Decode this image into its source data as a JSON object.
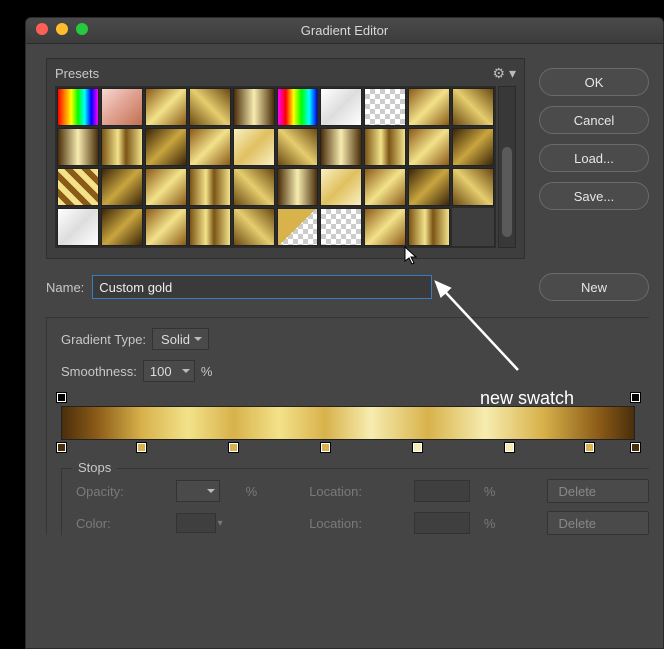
{
  "window": {
    "title": "Gradient Editor"
  },
  "presets": {
    "label": "Presets",
    "gear_icon": "gear"
  },
  "buttons": {
    "ok": "OK",
    "cancel": "Cancel",
    "load": "Load...",
    "save": "Save...",
    "new": "New"
  },
  "name": {
    "label": "Name:",
    "value": "Custom gold"
  },
  "gradient_type": {
    "label": "Gradient Type:",
    "value": "Solid"
  },
  "smoothness": {
    "label": "Smoothness:",
    "value": "100",
    "unit": "%"
  },
  "gradient": {
    "opacity_stops": [
      {
        "pos": 0,
        "color": "#000"
      },
      {
        "pos": 100,
        "color": "#000"
      }
    ],
    "color_stops": [
      {
        "pos": 0,
        "color": "#4a2e0b"
      },
      {
        "pos": 14,
        "color": "#d8b24b"
      },
      {
        "pos": 30,
        "color": "#d8b24b"
      },
      {
        "pos": 46,
        "color": "#d8b24b"
      },
      {
        "pos": 62,
        "color": "#f7ecb0"
      },
      {
        "pos": 78,
        "color": "#f7ecb0"
      },
      {
        "pos": 92,
        "color": "#d8b24b"
      },
      {
        "pos": 100,
        "color": "#4a2e0b"
      }
    ]
  },
  "stops": {
    "label": "Stops",
    "opacity_label": "Opacity:",
    "color_label": "Color:",
    "location_label": "Location:",
    "percent": "%",
    "delete": "Delete"
  },
  "annotation": {
    "text": "new swatch"
  },
  "swatch_classes": [
    "g-rainbow",
    "g-pink",
    "g-gold1",
    "g-gold2",
    "g-gold3",
    "g-rainbow2",
    "g-white",
    "g-trans",
    "g-gold1",
    "g-gold2",
    "g-gold3",
    "g-mgold",
    "g-dgold",
    "g-gold1",
    "g-lgold",
    "g-gold2",
    "g-gold3",
    "g-mgold",
    "g-gold1",
    "g-dgold",
    "g-stripe",
    "g-dgold",
    "g-gold1",
    "g-mgold",
    "g-gold2",
    "g-gold3",
    "g-lgold",
    "g-gold1",
    "g-dgold",
    "g-gold2",
    "g-white",
    "g-dgold",
    "g-gold1",
    "g-mgold",
    "g-gold2",
    "g-goldtrans",
    "g-trans",
    "g-gold1",
    "g-mgold",
    "g-empty"
  ]
}
